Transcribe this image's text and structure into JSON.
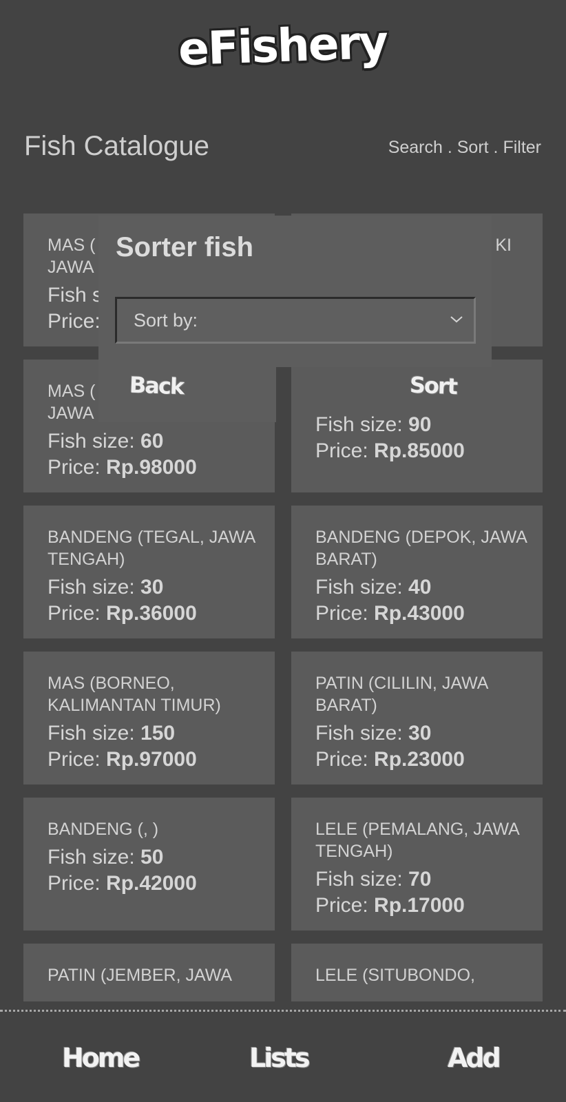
{
  "app": {
    "logo_text": "eFishery"
  },
  "header": {
    "title": "Fish Catalogue",
    "actions": "Search . Sort . Filter"
  },
  "labels": {
    "size_label": "Fish size: ",
    "price_label": "Price: "
  },
  "cards": [
    {
      "location": "",
      "size": "",
      "price": ""
    },
    {
      "location": "",
      "size": "",
      "price": ""
    },
    {
      "location": "MAS (… JAWA",
      "size": "",
      "price": "",
      "right_fragment": "KI"
    },
    {
      "location": "",
      "size": "",
      "price": ""
    },
    {
      "location": "MAS (… JAWA",
      "size": "60",
      "price": "Rp.98000"
    },
    {
      "location": "",
      "size": "90",
      "price": "Rp.85000"
    },
    {
      "location": "BANDENG (TEGAL, JAWA TENGAH)",
      "size": "30",
      "price": "Rp.36000"
    },
    {
      "location": "BANDENG (DEPOK, JAWA BARAT)",
      "size": "40",
      "price": "Rp.43000"
    },
    {
      "location": "MAS (BORNEO, KALIMANTAN TIMUR)",
      "size": "150",
      "price": "Rp.97000"
    },
    {
      "location": "PATIN (CILILIN, JAWA BARAT)",
      "size": "30",
      "price": "Rp.23000"
    },
    {
      "location": "BANDENG (, )",
      "size": "50",
      "price": "Rp.42000"
    },
    {
      "location": "LELE (PEMALANG, JAWA TENGAH)",
      "size": "70",
      "price": "Rp.17000"
    },
    {
      "location": "PATIN (JEMBER, JAWA",
      "size": "",
      "price": ""
    },
    {
      "location": "LELE (SITUBONDO,",
      "size": "",
      "price": ""
    }
  ],
  "modal": {
    "title": "Sorter fish",
    "select_placeholder": "Sort by:",
    "back_label": "Back",
    "sort_label": "Sort"
  },
  "nav": {
    "home": "Home",
    "lists": "Lists",
    "add": "Add"
  }
}
